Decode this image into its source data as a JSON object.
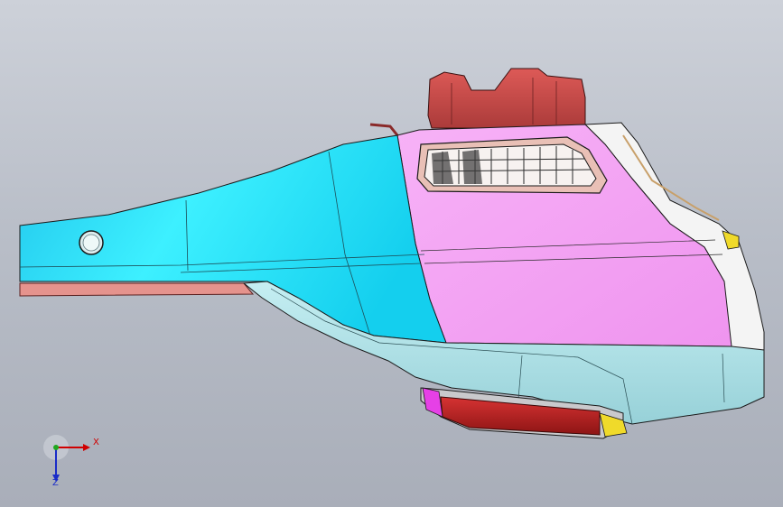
{
  "viewport": {
    "background_top": "#cdd1d9",
    "background_bottom": "#a9aeb9"
  },
  "model": {
    "colors": {
      "body_cyan": "#19d9f5",
      "side_panel_pink": "#f5a3f5",
      "lower_panel": "#a9dde2",
      "top_bracket": "#c9504f",
      "rear_lamp": "#b81f1f",
      "front_rim": "#f4f4f4",
      "rail_strip": "#e5938d",
      "reflector_yellow": "#f0da2a"
    }
  },
  "triad": {
    "x_label": "X",
    "z_label": "Z",
    "x_color": "#d00000",
    "y_color": "#1fa81f",
    "z_color": "#1a2cc8"
  }
}
